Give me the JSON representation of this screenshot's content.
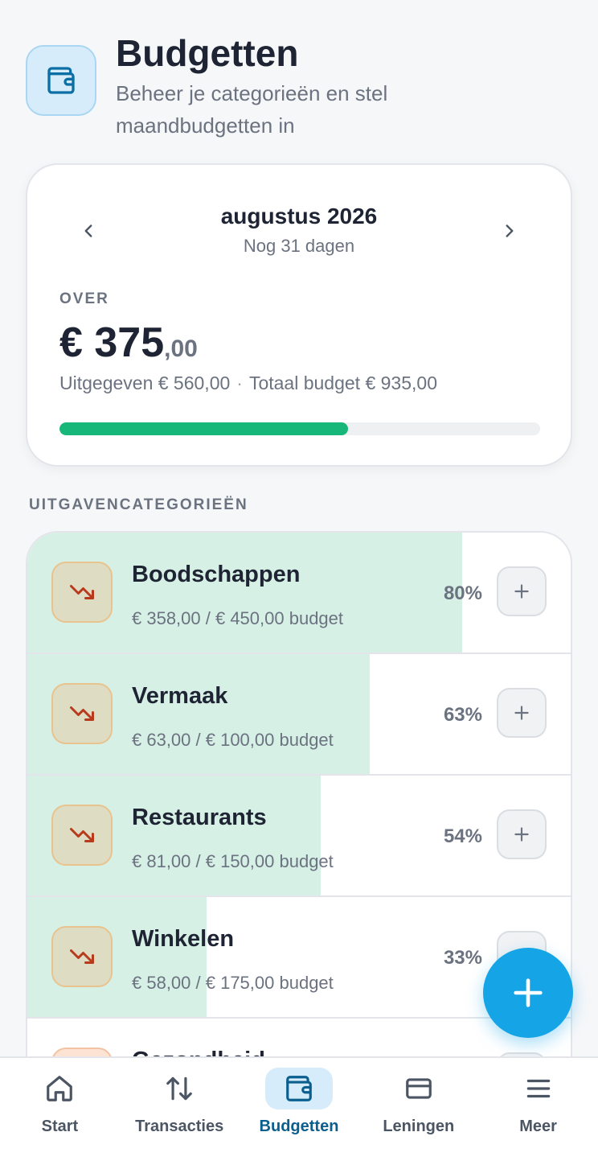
{
  "header": {
    "title": "Budgetten",
    "subtitle": "Beheer je categorieën en stel maandbudgetten in",
    "icon": "wallet-icon"
  },
  "summary": {
    "month": "augustus 2026",
    "days_left": "Nog 31 dagen",
    "over_label": "OVER",
    "amount_main": "€  375",
    "amount_cents": ",00",
    "spent_text": "Uitgegeven €  560,00",
    "separator": "·",
    "total_text": "Totaal budget €  935,00",
    "progress_fraction": 0.6,
    "progress_color": "#17b77a"
  },
  "section_label": "UITGAVENCATEGORIEËN",
  "categories": [
    {
      "name": "Boodschappen",
      "amount": "€  358,00 / €  450,00 budget",
      "percent": "80%",
      "fill": 0.8,
      "icon": "trending-down-icon"
    },
    {
      "name": "Vermaak",
      "amount": "€  63,00 / €  100,00 budget",
      "percent": "63%",
      "fill": 0.63,
      "icon": "trending-down-icon"
    },
    {
      "name": "Restaurants",
      "amount": "€  81,00 / €  150,00 budget",
      "percent": "54%",
      "fill": 0.54,
      "icon": "trending-down-icon"
    },
    {
      "name": "Winkelen",
      "amount": "€  58,00 / €  175,00 budget",
      "percent": "33%",
      "fill": 0.33,
      "icon": "trending-down-icon"
    },
    {
      "name": "Gezondheid",
      "amount": "",
      "percent": "",
      "fill": 0,
      "icon": "trending-down-icon"
    }
  ],
  "nav": [
    {
      "label": "Start",
      "icon": "home-icon",
      "active": false
    },
    {
      "label": "Transacties",
      "icon": "arrows-updown-icon",
      "active": false
    },
    {
      "label": "Budgetten",
      "icon": "wallet-icon",
      "active": true
    },
    {
      "label": "Leningen",
      "icon": "card-icon",
      "active": false
    },
    {
      "label": "Meer",
      "icon": "menu-icon",
      "active": false
    }
  ],
  "colors": {
    "accent": "#15a4e6",
    "fill": "#d7f0e5",
    "progress": "#17b77a"
  }
}
